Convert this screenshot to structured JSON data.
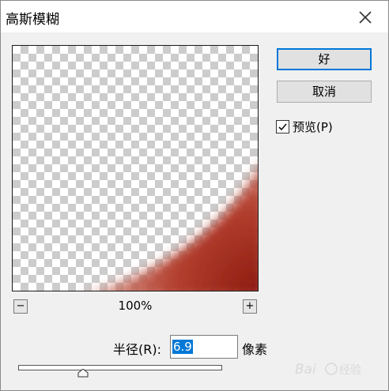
{
  "window": {
    "title": "高斯模糊"
  },
  "buttons": {
    "ok": "好",
    "cancel": "取消"
  },
  "preview_toggle": {
    "label": "预览(P)",
    "checked": true
  },
  "zoom": {
    "level": "100%",
    "minus": "−",
    "plus": "+"
  },
  "radius": {
    "label": "半径(R):",
    "value": "6.9",
    "unit": "像素",
    "slider_fraction": 0.32
  },
  "watermark": {
    "text": "Baidu经验"
  },
  "colors": {
    "accent": "#0078d7",
    "preview_red": "#b23a2a"
  }
}
